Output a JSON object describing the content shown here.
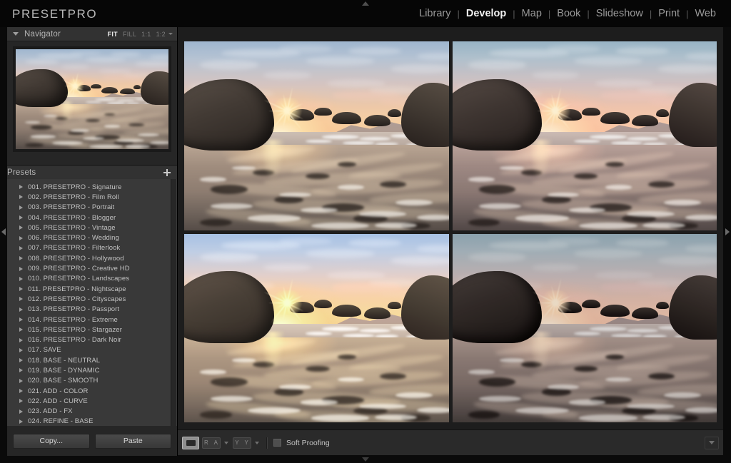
{
  "app": {
    "brand": "PRESETPRO",
    "active_module": "Develop",
    "separator": "|"
  },
  "modules": [
    {
      "label": "Library",
      "active": false
    },
    {
      "label": "Develop",
      "active": true
    },
    {
      "label": "Map",
      "active": false
    },
    {
      "label": "Book",
      "active": false
    },
    {
      "label": "Slideshow",
      "active": false
    },
    {
      "label": "Print",
      "active": false
    },
    {
      "label": "Web",
      "active": false
    }
  ],
  "navigator": {
    "title": "Navigator",
    "collapse_state": "expanded",
    "zoom_levels": [
      {
        "label": "FIT",
        "active": true
      },
      {
        "label": "FILL",
        "active": false
      },
      {
        "label": "1:1",
        "active": false
      },
      {
        "label": "1:2",
        "active": false
      }
    ]
  },
  "presets": {
    "title": "Presets",
    "add_label": "+",
    "items": [
      {
        "label": "001. PRESETPRO - Signature"
      },
      {
        "label": "002. PRESETPRO - Film Roll"
      },
      {
        "label": "003. PRESETPRO - Portrait"
      },
      {
        "label": "004. PRESETPRO - Blogger"
      },
      {
        "label": "005. PRESETPRO - Vintage"
      },
      {
        "label": "006. PRESETPRO - Wedding"
      },
      {
        "label": "007. PRESETPRO - Filterlook"
      },
      {
        "label": "008. PRESETPRO - Hollywood"
      },
      {
        "label": "009. PRESETPRO - Creative HD"
      },
      {
        "label": "010. PRESETPRO - Landscapes"
      },
      {
        "label": "011. PRESETPRO - Nightscape"
      },
      {
        "label": "012. PRESETPRO - Cityscapes"
      },
      {
        "label": "013. PRESETPRO - Passport"
      },
      {
        "label": "014. PRESETPRO - Extreme"
      },
      {
        "label": "015. PRESETPRO - Stargazer"
      },
      {
        "label": "016. PRESETPRO - Dark Noir"
      },
      {
        "label": "017. SAVE"
      },
      {
        "label": "018. BASE - NEUTRAL"
      },
      {
        "label": "019. BASE - DYNAMIC"
      },
      {
        "label": "020. BASE - SMOOTH"
      },
      {
        "label": "021. ADD - COLOR"
      },
      {
        "label": "022. ADD - CURVE"
      },
      {
        "label": "023. ADD - FX"
      },
      {
        "label": "024. REFINE - BASE"
      }
    ]
  },
  "panel_buttons": {
    "copy_label": "Copy...",
    "paste_label": "Paste"
  },
  "preview_grid": {
    "layout": "2x2",
    "cells": [
      {
        "position": "top-left",
        "grade": "original-warm-sunset"
      },
      {
        "position": "top-right",
        "grade": "cool-teal-shadows"
      },
      {
        "position": "bottom-left",
        "grade": "warm-vibrant-golden"
      },
      {
        "position": "bottom-right",
        "grade": "cool-desaturated-moody"
      }
    ],
    "subject": "coastal sunset beach with boulders, sunstar and wet reflective sand"
  },
  "toolbar": {
    "view_loupe": "loupe-view",
    "view_before_after": "R A",
    "view_split": "Y Y",
    "soft_proofing_label": "Soft Proofing",
    "soft_proofing_checked": false
  },
  "edge_arrows": {
    "left": "collapse-left-panel",
    "right": "collapse-right-panel",
    "top": "collapse-top-panel",
    "bottom": "collapse-filmstrip"
  },
  "colors": {
    "app_background": "#0a0a0a",
    "panel_background": "#262626",
    "panel_header": "#323232",
    "list_background": "#393939",
    "text_primary": "#c2c2c2",
    "text_active": "#f2f2f2",
    "content_background": "#1d1d1d"
  }
}
